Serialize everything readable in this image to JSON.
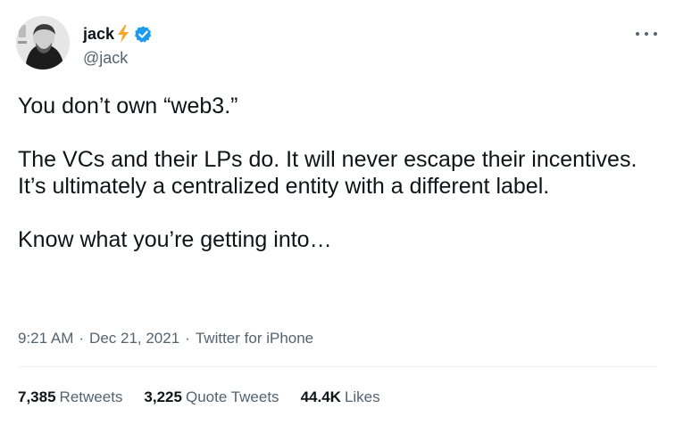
{
  "user": {
    "display_name": "jack",
    "handle": "@jack",
    "verified": true
  },
  "tweet": {
    "paragraphs": [
      "You don’t own “web3.”",
      "The VCs and their LPs do. It will never escape their incentives. It’s ultimately a centralized entity with a different label.",
      "Know what you’re getting into…"
    ],
    "time": "9:21 AM",
    "date": "Dec 21, 2021",
    "source": "Twitter for iPhone",
    "separator": "·"
  },
  "stats": {
    "retweets_count": "7,385",
    "retweets_label": "Retweets",
    "quote_count": "3,225",
    "quote_label": "Quote Tweets",
    "likes_count": "44.4K",
    "likes_label": "Likes"
  },
  "colors": {
    "text_primary": "#0f1419",
    "text_secondary": "#536471",
    "verified_blue": "#1d9bf0",
    "bolt_orange": "#f5a623",
    "divider": "#eff3f4"
  },
  "icons": {
    "bolt": "lightning-bolt-icon",
    "verified": "verified-badge-icon",
    "more": "more-options-icon"
  }
}
